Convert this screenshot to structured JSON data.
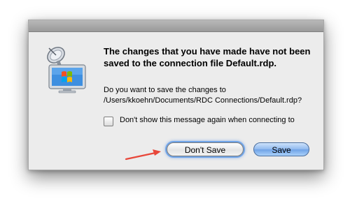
{
  "dialog": {
    "headline": "The changes that you have made have not been saved to the connection file Default.rdp.",
    "message": "Do you want to save the changes to /Users/kkoehn/Documents/RDC Connections/Default.rdp?",
    "checkbox_label": "Don't show this message again when connecting to",
    "checkbox_checked": false,
    "dont_save_label": "Don't Save",
    "save_label": "Save",
    "app_icon": "remote-desktop-connection-icon"
  },
  "colors": {
    "dialog_background": "#ececec",
    "default_button": "#7fb0ec",
    "focus_ring": "#6fa4e8",
    "annotation_arrow": "#e8473a"
  },
  "annotation": {
    "icon": "red-arrow-icon"
  }
}
